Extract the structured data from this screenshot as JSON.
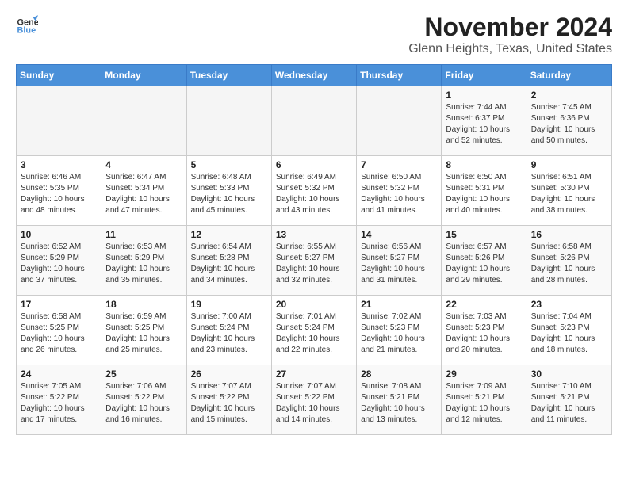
{
  "header": {
    "logo_line1": "General",
    "logo_line2": "Blue",
    "month": "November 2024",
    "location": "Glenn Heights, Texas, United States"
  },
  "days_of_week": [
    "Sunday",
    "Monday",
    "Tuesday",
    "Wednesday",
    "Thursday",
    "Friday",
    "Saturday"
  ],
  "weeks": [
    [
      {
        "day": "",
        "info": ""
      },
      {
        "day": "",
        "info": ""
      },
      {
        "day": "",
        "info": ""
      },
      {
        "day": "",
        "info": ""
      },
      {
        "day": "",
        "info": ""
      },
      {
        "day": "1",
        "info": "Sunrise: 7:44 AM\nSunset: 6:37 PM\nDaylight: 10 hours and 52 minutes."
      },
      {
        "day": "2",
        "info": "Sunrise: 7:45 AM\nSunset: 6:36 PM\nDaylight: 10 hours and 50 minutes."
      }
    ],
    [
      {
        "day": "3",
        "info": "Sunrise: 6:46 AM\nSunset: 5:35 PM\nDaylight: 10 hours and 48 minutes."
      },
      {
        "day": "4",
        "info": "Sunrise: 6:47 AM\nSunset: 5:34 PM\nDaylight: 10 hours and 47 minutes."
      },
      {
        "day": "5",
        "info": "Sunrise: 6:48 AM\nSunset: 5:33 PM\nDaylight: 10 hours and 45 minutes."
      },
      {
        "day": "6",
        "info": "Sunrise: 6:49 AM\nSunset: 5:32 PM\nDaylight: 10 hours and 43 minutes."
      },
      {
        "day": "7",
        "info": "Sunrise: 6:50 AM\nSunset: 5:32 PM\nDaylight: 10 hours and 41 minutes."
      },
      {
        "day": "8",
        "info": "Sunrise: 6:50 AM\nSunset: 5:31 PM\nDaylight: 10 hours and 40 minutes."
      },
      {
        "day": "9",
        "info": "Sunrise: 6:51 AM\nSunset: 5:30 PM\nDaylight: 10 hours and 38 minutes."
      }
    ],
    [
      {
        "day": "10",
        "info": "Sunrise: 6:52 AM\nSunset: 5:29 PM\nDaylight: 10 hours and 37 minutes."
      },
      {
        "day": "11",
        "info": "Sunrise: 6:53 AM\nSunset: 5:29 PM\nDaylight: 10 hours and 35 minutes."
      },
      {
        "day": "12",
        "info": "Sunrise: 6:54 AM\nSunset: 5:28 PM\nDaylight: 10 hours and 34 minutes."
      },
      {
        "day": "13",
        "info": "Sunrise: 6:55 AM\nSunset: 5:27 PM\nDaylight: 10 hours and 32 minutes."
      },
      {
        "day": "14",
        "info": "Sunrise: 6:56 AM\nSunset: 5:27 PM\nDaylight: 10 hours and 31 minutes."
      },
      {
        "day": "15",
        "info": "Sunrise: 6:57 AM\nSunset: 5:26 PM\nDaylight: 10 hours and 29 minutes."
      },
      {
        "day": "16",
        "info": "Sunrise: 6:58 AM\nSunset: 5:26 PM\nDaylight: 10 hours and 28 minutes."
      }
    ],
    [
      {
        "day": "17",
        "info": "Sunrise: 6:58 AM\nSunset: 5:25 PM\nDaylight: 10 hours and 26 minutes."
      },
      {
        "day": "18",
        "info": "Sunrise: 6:59 AM\nSunset: 5:25 PM\nDaylight: 10 hours and 25 minutes."
      },
      {
        "day": "19",
        "info": "Sunrise: 7:00 AM\nSunset: 5:24 PM\nDaylight: 10 hours and 23 minutes."
      },
      {
        "day": "20",
        "info": "Sunrise: 7:01 AM\nSunset: 5:24 PM\nDaylight: 10 hours and 22 minutes."
      },
      {
        "day": "21",
        "info": "Sunrise: 7:02 AM\nSunset: 5:23 PM\nDaylight: 10 hours and 21 minutes."
      },
      {
        "day": "22",
        "info": "Sunrise: 7:03 AM\nSunset: 5:23 PM\nDaylight: 10 hours and 20 minutes."
      },
      {
        "day": "23",
        "info": "Sunrise: 7:04 AM\nSunset: 5:23 PM\nDaylight: 10 hours and 18 minutes."
      }
    ],
    [
      {
        "day": "24",
        "info": "Sunrise: 7:05 AM\nSunset: 5:22 PM\nDaylight: 10 hours and 17 minutes."
      },
      {
        "day": "25",
        "info": "Sunrise: 7:06 AM\nSunset: 5:22 PM\nDaylight: 10 hours and 16 minutes."
      },
      {
        "day": "26",
        "info": "Sunrise: 7:07 AM\nSunset: 5:22 PM\nDaylight: 10 hours and 15 minutes."
      },
      {
        "day": "27",
        "info": "Sunrise: 7:07 AM\nSunset: 5:22 PM\nDaylight: 10 hours and 14 minutes."
      },
      {
        "day": "28",
        "info": "Sunrise: 7:08 AM\nSunset: 5:21 PM\nDaylight: 10 hours and 13 minutes."
      },
      {
        "day": "29",
        "info": "Sunrise: 7:09 AM\nSunset: 5:21 PM\nDaylight: 10 hours and 12 minutes."
      },
      {
        "day": "30",
        "info": "Sunrise: 7:10 AM\nSunset: 5:21 PM\nDaylight: 10 hours and 11 minutes."
      }
    ]
  ]
}
